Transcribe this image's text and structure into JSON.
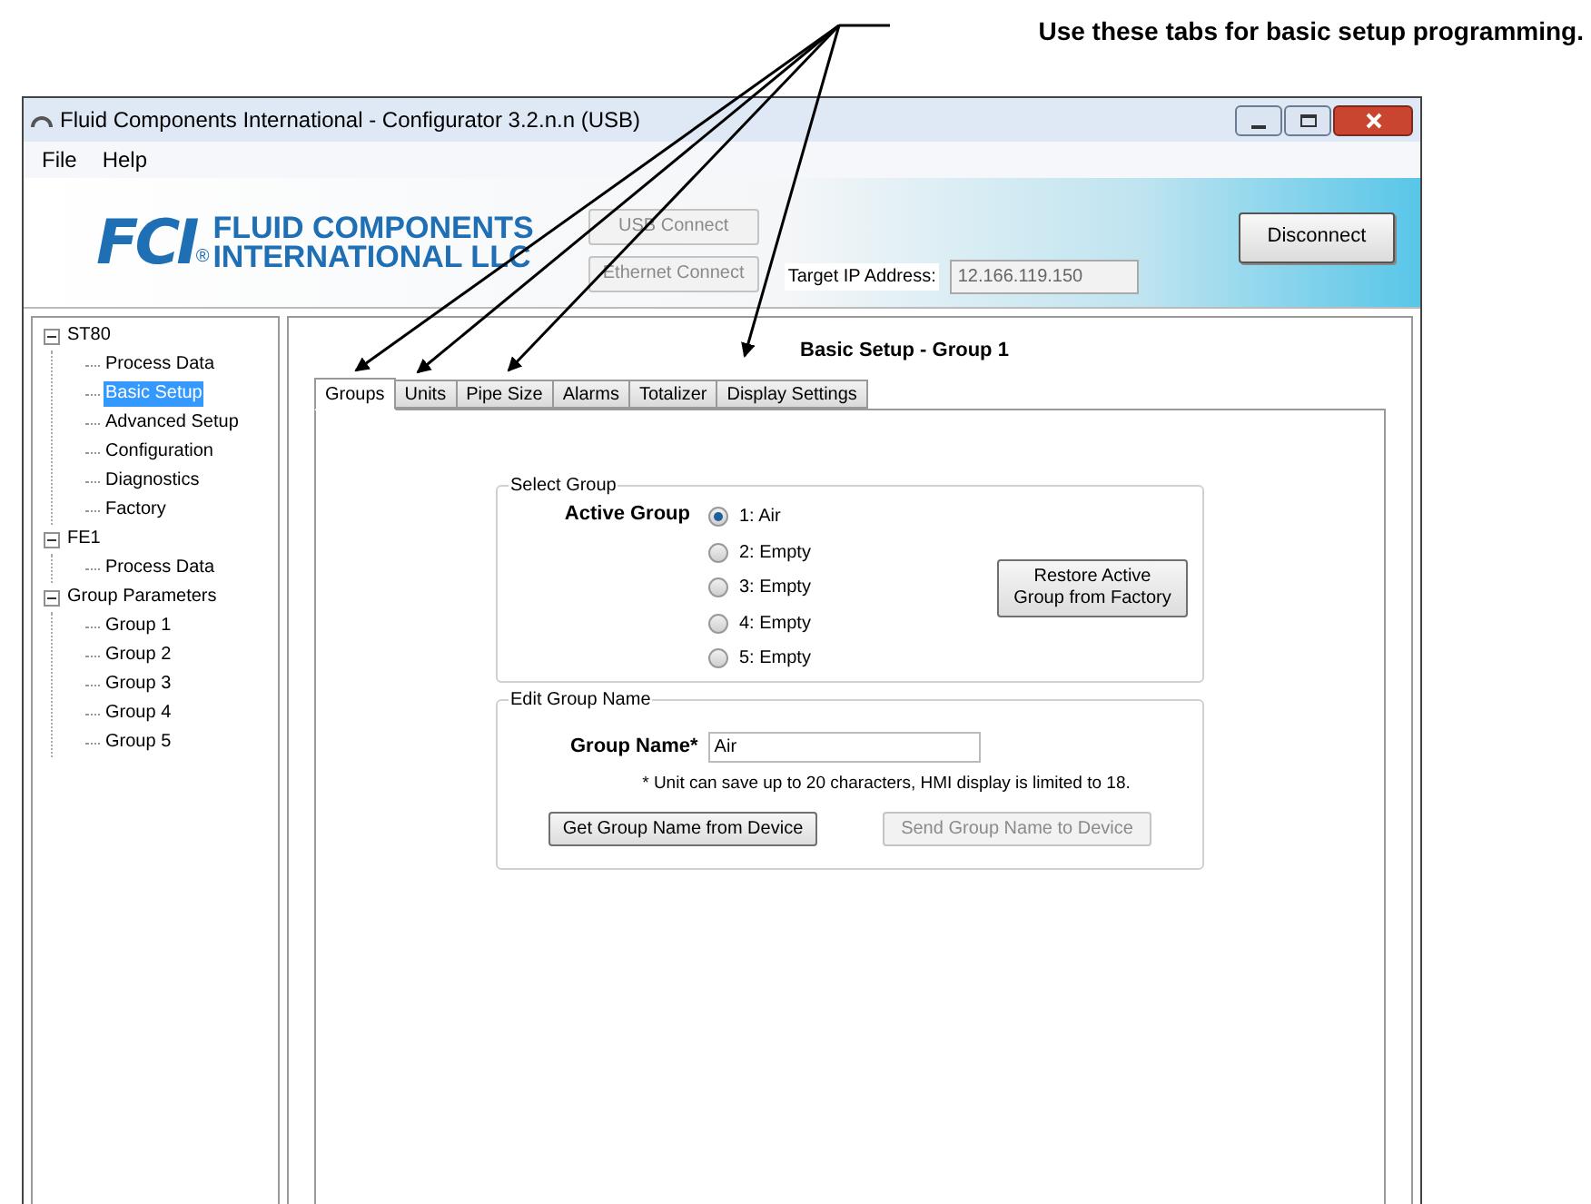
{
  "annotation": {
    "text": "Use these tabs for basic setup programming."
  },
  "window": {
    "title": "Fluid Components International - Configurator 3.2.n.n (USB)"
  },
  "menu": [
    "File",
    "Help"
  ],
  "banner": {
    "logo_mark": "FCI",
    "logo_registered": "®",
    "logo_line_1": "FLUID COMPONENTS",
    "logo_line_2": "INTERNATIONAL LLC",
    "buttons": [
      {
        "label": "USB Connect",
        "disabled": true
      },
      {
        "label": "Ethernet Connect",
        "disabled": true
      }
    ],
    "ip_label": "Target IP Address:",
    "ip_value": "12.166.119.150",
    "disconnect": "Disconnect"
  },
  "tree": [
    {
      "label": "ST80",
      "expanded": true,
      "selected": false,
      "children": [
        {
          "label": "Process Data",
          "selected": false
        },
        {
          "label": "Basic Setup",
          "selected": true
        },
        {
          "label": "Advanced Setup",
          "selected": false
        },
        {
          "label": "Configuration",
          "selected": false
        },
        {
          "label": "Diagnostics",
          "selected": false
        },
        {
          "label": "Factory",
          "selected": false
        }
      ]
    },
    {
      "label": "FE1",
      "expanded": true,
      "selected": false,
      "children": [
        {
          "label": "Process Data",
          "selected": false
        }
      ]
    },
    {
      "label": "Group Parameters",
      "expanded": true,
      "selected": false,
      "children": [
        {
          "label": "Group 1",
          "selected": false
        },
        {
          "label": "Group 2",
          "selected": false
        },
        {
          "label": "Group 3",
          "selected": false
        },
        {
          "label": "Group 4",
          "selected": false
        },
        {
          "label": "Group 5",
          "selected": false
        }
      ]
    }
  ],
  "panel_title": "Basic Setup - Group 1",
  "tabs": [
    {
      "label": "Groups",
      "selected": true
    },
    {
      "label": "Units",
      "selected": false
    },
    {
      "label": "Pipe Size",
      "selected": false
    },
    {
      "label": "Alarms",
      "selected": false
    },
    {
      "label": "Totalizer",
      "selected": false
    },
    {
      "label": "Display Settings",
      "selected": false
    }
  ],
  "select_group": {
    "title": "Select Group",
    "label": "Active Group",
    "options": [
      {
        "label": "1: Air",
        "selected": true
      },
      {
        "label": "2: Empty",
        "selected": false
      },
      {
        "label": "3: Empty",
        "selected": false
      },
      {
        "label": "4: Empty",
        "selected": false
      },
      {
        "label": "5: Empty",
        "selected": false
      }
    ],
    "restore_button": {
      "label": "Restore Active Group from Factory",
      "disabled": false
    }
  },
  "edit_group_name": {
    "title": "Edit Group Name",
    "label": "Group Name*",
    "value": "Air",
    "note": "* Unit can save up to 20 characters, HMI display is limited to 18.",
    "buttons": [
      {
        "label": "Get Group Name from Device",
        "disabled": false
      },
      {
        "label": "Send Group Name to Device",
        "disabled": true
      }
    ]
  }
}
